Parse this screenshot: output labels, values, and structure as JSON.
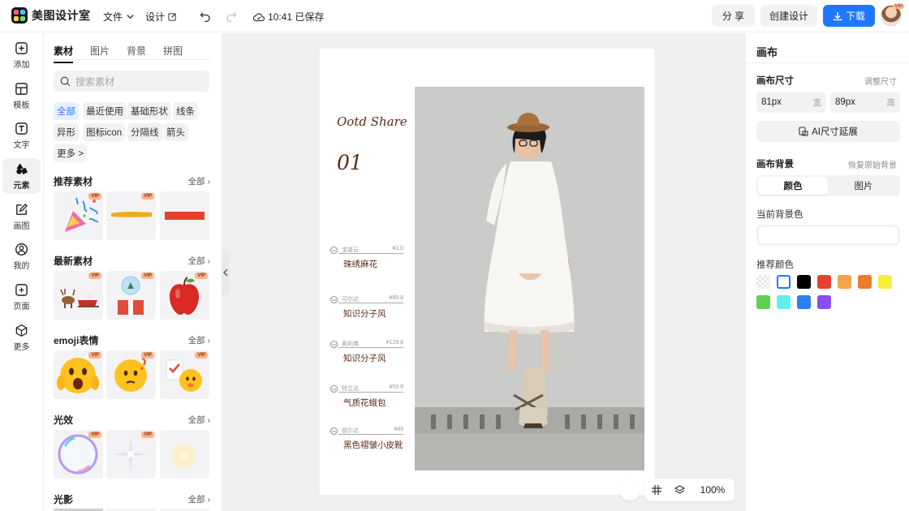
{
  "app": {
    "name": "美图设计室"
  },
  "topbar": {
    "menu_file": "文件",
    "menu_design": "设计",
    "save_status": "10:41 已保存",
    "share_label": "分 享",
    "create_label": "创建设计",
    "download_label": "下载",
    "avatar_badge": "VIP"
  },
  "leftnav": {
    "items": [
      {
        "label": "添加",
        "icon": "plus-square-icon"
      },
      {
        "label": "模板",
        "icon": "template-icon"
      },
      {
        "label": "文字",
        "icon": "text-icon"
      },
      {
        "label": "元素",
        "icon": "shapes-icon"
      },
      {
        "label": "画图",
        "icon": "pencil-icon"
      },
      {
        "label": "我的",
        "icon": "user-icon"
      },
      {
        "label": "页面",
        "icon": "page-add-icon"
      },
      {
        "label": "更多",
        "icon": "cube-icon"
      }
    ],
    "active_index": 3
  },
  "assets": {
    "tabs": [
      "素材",
      "图片",
      "背景",
      "拼图"
    ],
    "active_tab": 0,
    "search_placeholder": "搜索素材",
    "chips": [
      "全部",
      "最近使用",
      "基础形状",
      "线条",
      "异形",
      "图标icon",
      "分隔线",
      "箭头",
      "更多 >"
    ],
    "vip_badge": "VIP",
    "sections": [
      {
        "title": "推荐素材",
        "all": "全部"
      },
      {
        "title": "最新素材",
        "all": "全部"
      },
      {
        "title": "emoji表情",
        "all": "全部"
      },
      {
        "title": "光效",
        "all": "全部"
      },
      {
        "title": "光影",
        "all": "全部"
      }
    ]
  },
  "canvas": {
    "heading": "Ootd Share",
    "number": "01",
    "items": [
      {
        "brand": "宝姿云",
        "price": "¥1,0",
        "label": "珠绣麻花"
      },
      {
        "brand": "可尔达",
        "price": "¥89.8",
        "label": "知识分子风"
      },
      {
        "brand": "奥利弗",
        "price": "¥129.8",
        "label": "知识分子风"
      },
      {
        "brand": "特立达",
        "price": "¥59.9",
        "label": "气质花蛾包"
      },
      {
        "brand": "德尔达",
        "price": "¥89",
        "label": "黑色褶皱小皮靴"
      }
    ],
    "zoom": "100%"
  },
  "rightpanel": {
    "title": "画布",
    "size_label": "画布尺寸",
    "size_hint": "调整尺寸",
    "width_value": "81px",
    "width_unit": "宽",
    "height_value": "89px",
    "height_unit": "高",
    "ai_extend": "AI尺寸延展",
    "bg_label": "画布背景",
    "bg_hint": "恢复原始背景",
    "seg_color": "颜色",
    "seg_image": "图片",
    "current_bg_label": "当前背景色",
    "rec_colors_label": "推荐颜色",
    "colors": [
      "transparent",
      "#ffffff",
      "#000000",
      "#e8402e",
      "#f5a34a",
      "#ee7b2d",
      "#f7ee3a",
      "#5fd04f",
      "#62eeee",
      "#2f7ff0",
      "#8a4ef0"
    ]
  }
}
